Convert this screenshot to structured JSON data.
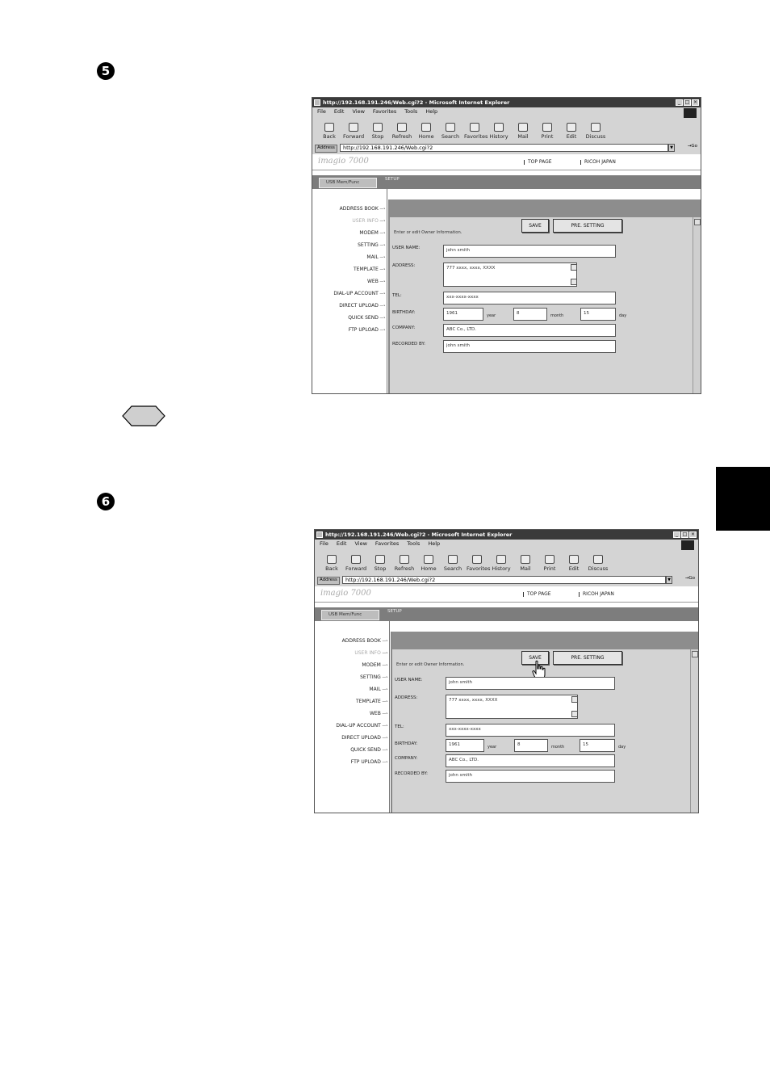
{
  "page": {
    "step5": {
      "number": "5"
    },
    "step6": {
      "number": "6"
    },
    "note_marker": ""
  },
  "screens": [
    {
      "id": "screen-step5",
      "title": "http://192.168.191.246/Web.cgi?2 - Microsoft Internet Explorer",
      "menu": [
        "File",
        "Edit",
        "View",
        "Favorites",
        "Tools",
        "Help"
      ],
      "toolbar": [
        "Back",
        "Forward",
        "Stop",
        "Refresh",
        "Home",
        "Search",
        "Favorites",
        "History",
        "Mail",
        "Print",
        "Edit",
        "Discuss"
      ],
      "address_label": "Address",
      "address_value": "http://192.168.191.246/Web.cgi?2",
      "go_label": "→Go",
      "logo": "imagio 7000",
      "top_links": [
        "TOP PAGE",
        "RICOH JAPAN"
      ],
      "tabs": [
        "USB Mem/Func",
        "SETUP"
      ],
      "side_menu": [
        "ADDRESS BOOK",
        "USER INFO",
        "MODEM",
        "SETTING",
        "MAIL",
        "TEMPLATE",
        "WEB",
        "DIAL-UP ACCOUNT",
        "DIRECT UPLOAD",
        "QUICK SEND",
        "FTP UPLOAD"
      ],
      "instruction": "Enter or edit Owner Information.",
      "buttons": {
        "save": "SAVE",
        "pre_setting": "PRE. SETTING"
      },
      "fields": {
        "user_name_label": "USER NAME:",
        "user_name_value": "john smith",
        "address_label": "ADDRESS:",
        "address_value": "777 xxxx, xxxx, XXXX",
        "tel_label": "TEL:",
        "tel_value": "xxx-xxxx-xxxx",
        "birthday_label": "BIRTHDAY:",
        "birthday_year": "1961",
        "year_unit": "year",
        "birthday_month": "8",
        "month_unit": "month",
        "birthday_day": "15",
        "day_unit": "day",
        "company_label": "COMPANY:",
        "company_value": "ABC Co., LTD.",
        "recorded_by_label": "RECORDED BY:",
        "recorded_by_value": "john smith"
      }
    },
    {
      "id": "screen-step6",
      "title": "http://192.168.191.246/Web.cgi?2 - Microsoft Internet Explorer",
      "menu": [
        "File",
        "Edit",
        "View",
        "Favorites",
        "Tools",
        "Help"
      ],
      "toolbar": [
        "Back",
        "Forward",
        "Stop",
        "Refresh",
        "Home",
        "Search",
        "Favorites",
        "History",
        "Mail",
        "Print",
        "Edit",
        "Discuss"
      ],
      "address_label": "Address",
      "address_value": "http://192.168.191.246/Web.cgi?2",
      "go_label": "→Go",
      "logo": "imagio 7000",
      "top_links": [
        "TOP PAGE",
        "RICOH JAPAN"
      ],
      "tabs": [
        "USB Mem/Func",
        "SETUP"
      ],
      "side_menu": [
        "ADDRESS BOOK",
        "USER INFO",
        "MODEM",
        "SETTING",
        "MAIL",
        "TEMPLATE",
        "WEB",
        "DIAL-UP ACCOUNT",
        "DIRECT UPLOAD",
        "QUICK SEND",
        "FTP UPLOAD"
      ],
      "instruction": "Enter or edit Owner Information.",
      "buttons": {
        "save": "SAVE",
        "pre_setting": "PRE. SETTING"
      },
      "fields": {
        "user_name_label": "USER NAME:",
        "user_name_value": "john smith",
        "address_label": "ADDRESS:",
        "address_value": "777 xxxx, xxxx, XXXX",
        "tel_label": "TEL:",
        "tel_value": "xxx-xxxx-xxxx",
        "birthday_label": "BIRTHDAY:",
        "birthday_year": "1961",
        "year_unit": "year",
        "birthday_month": "8",
        "month_unit": "month",
        "birthday_day": "15",
        "day_unit": "day",
        "company_label": "COMPANY:",
        "company_value": "ABC Co., LTD.",
        "recorded_by_label": "RECORDED BY:",
        "recorded_by_value": "john smith"
      },
      "cursor": "hand-pointer-icon"
    }
  ]
}
